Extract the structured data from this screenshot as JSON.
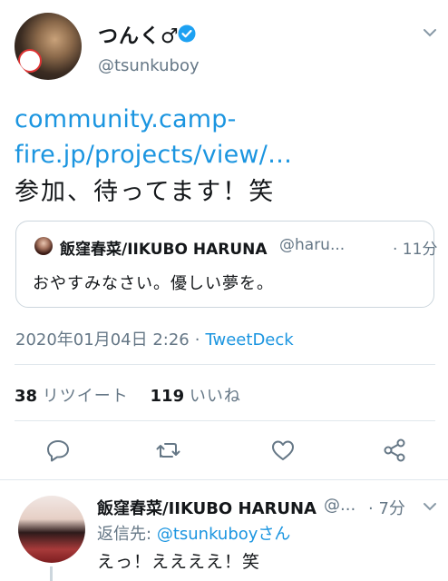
{
  "tweet": {
    "display_name": "つんく♂",
    "screen_name": "@tsunkuboy",
    "link_text": "community.camp-fire.jp/projects/view/…",
    "text": "参加、待ってます！笑",
    "quoted": {
      "name": "飯窪春菜/IIKUBO HARUNA",
      "handle": "@haru...",
      "time": "· 11分",
      "text": "おやすみなさい。優しい夢を。"
    },
    "timestamp": "2020年01月04日 2:26",
    "separator": "·",
    "source": "TweetDeck",
    "stats": {
      "retweet_count": "38",
      "retweet_label": "リツイート",
      "like_count": "119",
      "like_label": "いいね"
    },
    "actions": [
      "reply-icon",
      "retweet-icon",
      "like-icon",
      "share-icon"
    ]
  },
  "reply": {
    "name": "飯窪春菜/IIKUBO HARUNA",
    "handle": "@...",
    "time": "· 7分",
    "reply_to_prefix": "返信先:",
    "reply_to_mention": "@tsunkuboyさん",
    "text": "えっ！ええええ！笑"
  },
  "colors": {
    "accent": "#1b95e0",
    "secondary_text": "#657786",
    "border": "#e1e8ed"
  }
}
